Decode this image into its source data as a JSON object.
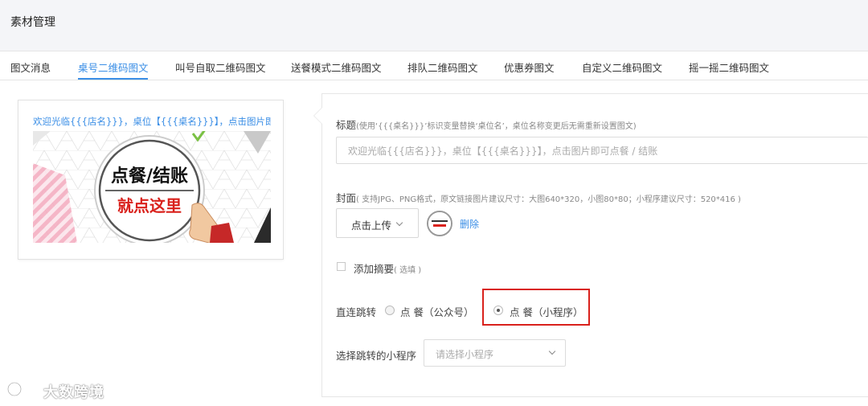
{
  "header": {
    "title": "素材管理"
  },
  "tabs": [
    {
      "label": "图文消息"
    },
    {
      "label": "桌号二维码图文",
      "active": true
    },
    {
      "label": "叫号自取二维码图文"
    },
    {
      "label": "送餐模式二维码图文"
    },
    {
      "label": "排队二维码图文"
    },
    {
      "label": "优惠券图文"
    },
    {
      "label": "自定义二维码图文"
    },
    {
      "label": "摇一摇二维码图文"
    }
  ],
  "preview": {
    "title": "欢迎光临{{{店名}}}，桌位【{{{桌名}}}】，点击图片即...",
    "banner_line1": "点餐/结账",
    "banner_line2": "就点这里"
  },
  "form": {
    "title_label": "标题",
    "title_hint": "(使用‘{{{桌名}}}’标识变量替换‘桌位名’，桌位名称变更后无需重新设置图文)",
    "title_placeholder": "欢迎光临{{{店名}}}，桌位【{{{桌名}}}】，点击图片即可点餐 / 结账",
    "cover_label": "封面",
    "cover_hint": "( 支持JPG、PNG格式，原文链接图片建议尺寸：大图640*320，小图80*80；小程序建议尺寸：520*416 )",
    "upload_label": "点击上传",
    "delete_label": "删除",
    "summary_label": "添加摘要",
    "summary_hint": "( 选填 )",
    "jump_label": "直连跳转",
    "jump_options": [
      {
        "label": "点 餐（公众号）",
        "checked": false
      },
      {
        "label": "点 餐（小程序）",
        "checked": true
      }
    ],
    "mini_label": "选择跳转的小程序",
    "mini_placeholder": "请选择小程序"
  },
  "watermark": {
    "text": "大数跨境"
  },
  "colors": {
    "accent": "#3a8ee6",
    "highlight": "#d9211c"
  }
}
